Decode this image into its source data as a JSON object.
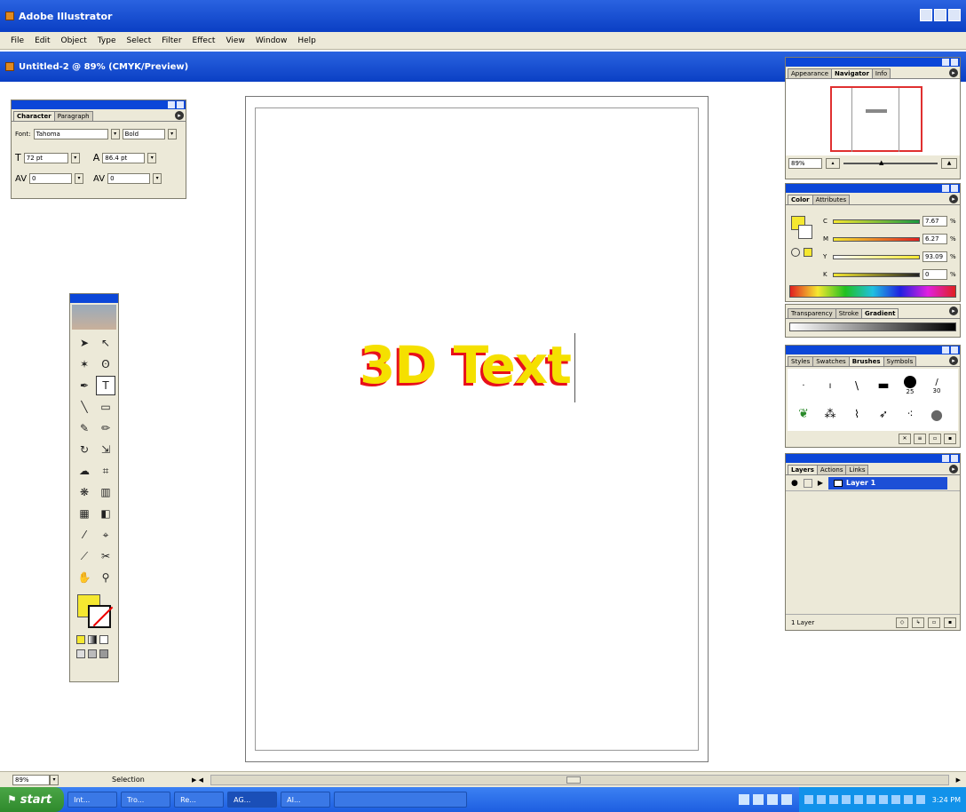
{
  "app": {
    "title": "Adobe Illustrator"
  },
  "menu": [
    "File",
    "Edit",
    "Object",
    "Type",
    "Select",
    "Filter",
    "Effect",
    "View",
    "Window",
    "Help"
  ],
  "document": {
    "title": "Untitled-2 @ 89% (CMYK/Preview)",
    "text": "3D Text"
  },
  "colors": {
    "text_fill": "#f5e000",
    "text_shadow": "#e8101a",
    "fill_swatch": "#f5e830"
  },
  "character_panel": {
    "tabs": [
      "Character",
      "Paragraph"
    ],
    "font_label": "Font:",
    "font_value": "Tahoma",
    "style_value": "Bold",
    "size_value": "72 pt",
    "leading_value": "86.4 pt",
    "kerning_value": "0",
    "tracking_value": "0"
  },
  "navigator_panel": {
    "tabs": [
      "Appearance",
      "Navigator",
      "Info"
    ],
    "zoom_value": "89%"
  },
  "color_panel": {
    "tabs": [
      "Color",
      "Attributes"
    ],
    "channels": [
      {
        "label": "C",
        "value": "7.67",
        "unit": "%"
      },
      {
        "label": "M",
        "value": "6.27",
        "unit": "%"
      },
      {
        "label": "Y",
        "value": "93.09",
        "unit": "%"
      },
      {
        "label": "K",
        "value": "0",
        "unit": "%"
      }
    ]
  },
  "gradient_panel": {
    "tabs": [
      "Transparency",
      "Stroke",
      "Gradient"
    ]
  },
  "brushes_panel": {
    "tabs": [
      "Styles",
      "Swatches",
      "Brushes",
      "Symbols"
    ],
    "sizes": [
      "25",
      "30"
    ]
  },
  "layers_panel": {
    "tabs": [
      "Layers",
      "Actions",
      "Links"
    ],
    "layer_name": "Layer 1",
    "footer": "1 Layer"
  },
  "status_bar": {
    "zoom": "89%",
    "tool": "Selection"
  },
  "taskbar": {
    "start": "start",
    "buttons": [
      "Int...",
      "Tro...",
      "Re...",
      "AG...",
      "AI..."
    ],
    "clock": "3:24 PM"
  }
}
